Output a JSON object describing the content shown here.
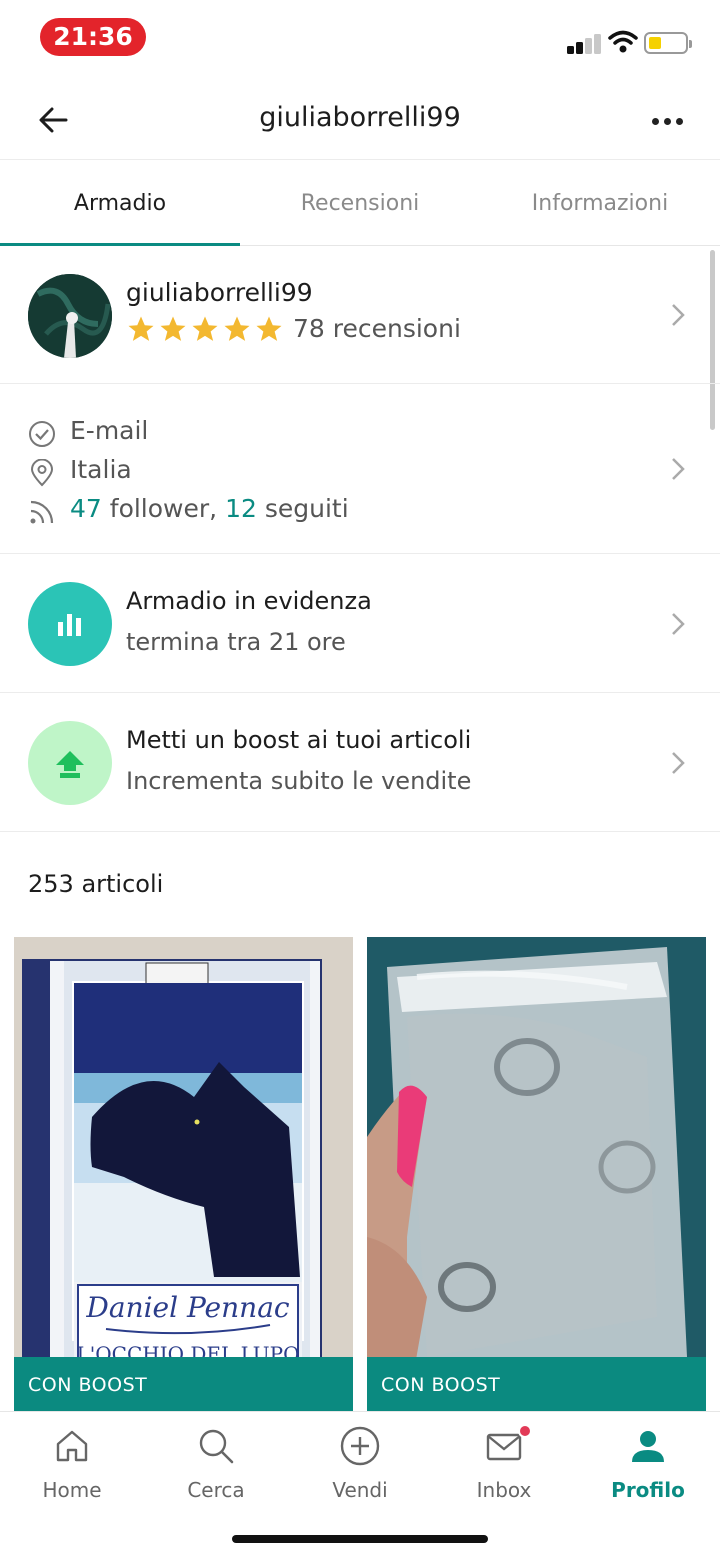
{
  "status_bar": {
    "time": "21:36",
    "battery_color": "#f5d100",
    "time_pill_color": "#e3242b"
  },
  "header": {
    "title": "giuliaborrelli99",
    "back_icon": "arrow-left-icon",
    "more_icon": "ellipsis-icon"
  },
  "tabs": [
    {
      "label": "Armadio",
      "active": true
    },
    {
      "label": "Recensioni",
      "active": false
    },
    {
      "label": "Informazioni",
      "active": false
    }
  ],
  "profile": {
    "username": "giuliaborrelli99",
    "rating": 5,
    "reviews": "78 recensioni"
  },
  "info": {
    "email": "E-mail",
    "location": "Italia",
    "followers_count": "47",
    "followers_label": "follower,",
    "following_count": "12",
    "following_label": "seguiti"
  },
  "featured": {
    "title": "Armadio in evidenza",
    "subtitle": "termina tra 21 ore",
    "icon": "bar-chart-icon",
    "color": "#2bc4b6"
  },
  "boost": {
    "title": "Metti un boost ai tuoi articoli",
    "subtitle": "Incrementa subito le vendite",
    "icon": "arrow-up-icon",
    "color": "#bff5c8"
  },
  "items_count": "253 articoli",
  "items": [
    {
      "badge": "CON BOOST",
      "cover_text": "Daniel Pennac",
      "cover_subtitle": "L'OCCHIO DEL LUPO"
    },
    {
      "badge": "CON BOOST"
    }
  ],
  "nav": [
    {
      "label": "Home",
      "icon": "home-icon"
    },
    {
      "label": "Cerca",
      "icon": "search-icon"
    },
    {
      "label": "Vendi",
      "icon": "plus-circle-icon"
    },
    {
      "label": "Inbox",
      "icon": "mail-icon"
    },
    {
      "label": "Profilo",
      "icon": "user-icon",
      "active": true
    }
  ],
  "accent_color": "#0a8b82"
}
